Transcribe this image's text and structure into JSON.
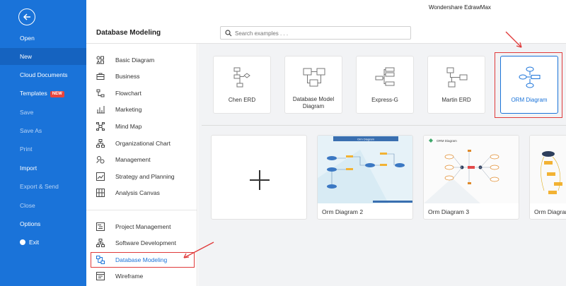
{
  "app": {
    "title": "Wondershare EdrawMax"
  },
  "rail": {
    "items": [
      {
        "label": "Open"
      },
      {
        "label": "New"
      },
      {
        "label": "Cloud Documents"
      },
      {
        "label": "Templates",
        "badge": "NEW"
      },
      {
        "label": "Save"
      },
      {
        "label": "Save As"
      },
      {
        "label": "Print"
      },
      {
        "label": "Import"
      },
      {
        "label": "Export & Send"
      },
      {
        "label": "Close"
      },
      {
        "label": "Options"
      },
      {
        "label": "Exit"
      }
    ]
  },
  "header": {
    "page_title": "Database Modeling",
    "search_placeholder": "Search examples . . ."
  },
  "categories": {
    "group1": [
      {
        "label": "Basic Diagram"
      },
      {
        "label": "Business"
      },
      {
        "label": "Flowchart"
      },
      {
        "label": "Marketing"
      },
      {
        "label": "Mind Map"
      },
      {
        "label": "Organizational Chart"
      },
      {
        "label": "Management"
      },
      {
        "label": "Strategy and Planning"
      },
      {
        "label": "Analysis Canvas"
      }
    ],
    "group2": [
      {
        "label": "Project Management"
      },
      {
        "label": "Software Development"
      },
      {
        "label": "Database Modeling"
      },
      {
        "label": "Wireframe"
      }
    ]
  },
  "templates": [
    {
      "label": "Chen ERD"
    },
    {
      "label": "Database Model Diagram"
    },
    {
      "label": "Express-G"
    },
    {
      "label": "Martin ERD"
    },
    {
      "label": "ORM Diagram"
    }
  ],
  "examples": [
    {
      "label": "Orm Diagram 2",
      "header": "Orm Diagram"
    },
    {
      "label": "Orm Diagram 3",
      "header": "ORM Diagram"
    },
    {
      "label": "Orm Diagram"
    }
  ],
  "colors": {
    "accent": "#1a73d9",
    "highlight": "#e03a3a",
    "rail": "#1a73d9"
  }
}
